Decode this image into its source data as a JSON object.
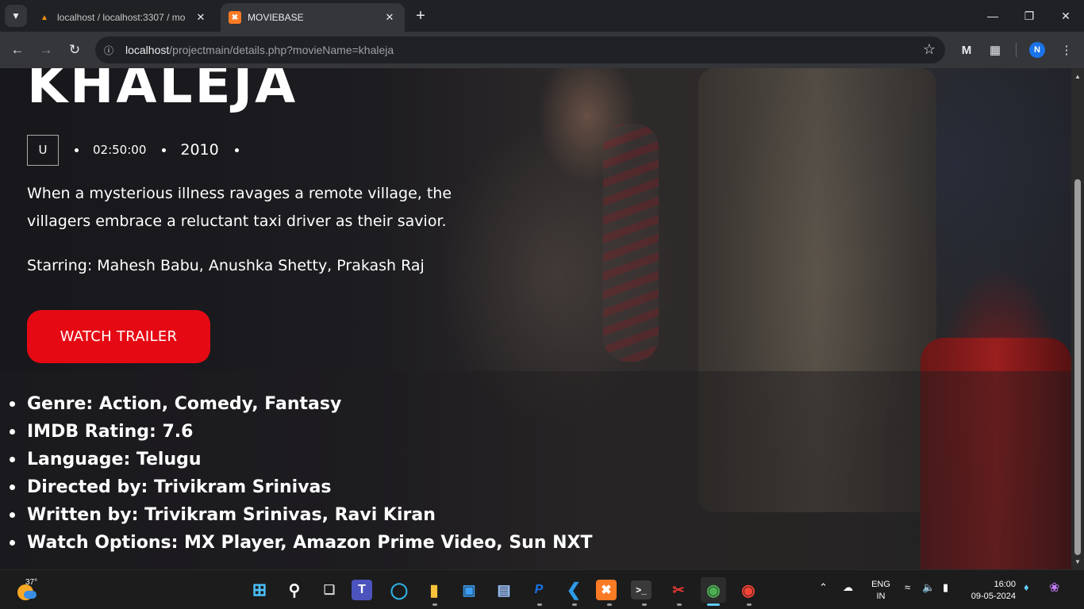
{
  "browser": {
    "tabs": [
      {
        "title": "localhost / localhost:3307 / mo",
        "active": false,
        "favicon": "phpmyadmin-icon"
      },
      {
        "title": "MOVIEBASE",
        "active": true,
        "favicon": "xampp-icon"
      }
    ],
    "url_host": "localhost",
    "url_path": "/projectmain/details.php?movieName=khaleja",
    "profile_initial": "N"
  },
  "movie": {
    "title": "KHALEJA",
    "certificate": "U",
    "duration": "02:50:00",
    "year": "2010",
    "synopsis": "When a mysterious illness ravages a remote village, the villagers embrace a reluctant taxi driver as their savior.",
    "starring": "Starring: Mahesh Babu, Anushka Shetty, Prakash Raj",
    "trailer_button": "WATCH TRAILER",
    "details": [
      "Genre: Action, Comedy, Fantasy",
      "IMDB Rating: 7.6",
      "Language: Telugu",
      "Directed by: Trivikram Srinivas",
      "Written by: Trivikram Srinivas, Ravi Kiran",
      "Watch Options: MX Player, Amazon Prime Video, Sun NXT"
    ]
  },
  "taskbar": {
    "weather_temp": "37°",
    "language_line1": "ENG",
    "language_line2": "IN",
    "time": "16:00",
    "date": "09-05-2024"
  },
  "colors": {
    "accent_button": "#e50914",
    "browser_frame": "#202124",
    "toolbar": "#35363a"
  }
}
